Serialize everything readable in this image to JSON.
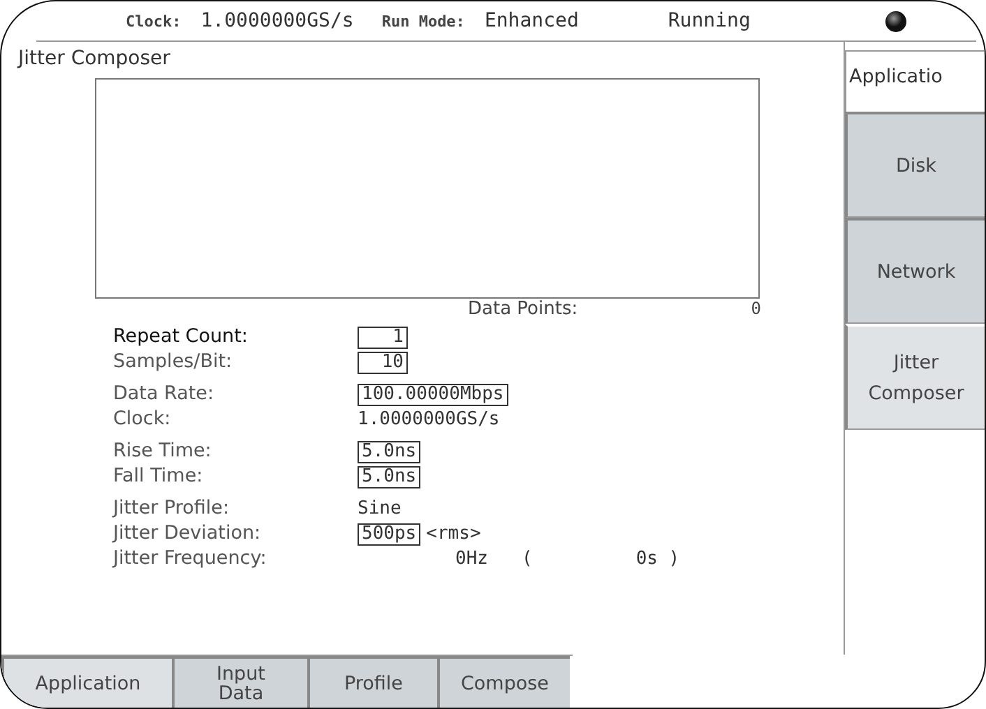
{
  "status_bar": {
    "clock_label": "Clock:",
    "clock_value": "1.0000000GS/s",
    "run_mode_label": "Run Mode:",
    "run_mode_value": "Enhanced",
    "state": "Running"
  },
  "panel_title": "Jitter Composer",
  "data_points": {
    "label": "Data Points:",
    "value": "0"
  },
  "groups": [
    [
      {
        "label": "Repeat Count:",
        "value": "1",
        "kind": "field",
        "emphasized": true
      },
      {
        "label": "Samples/Bit:",
        "value": "10",
        "kind": "field",
        "emphasized": false
      }
    ],
    [
      {
        "label": "Data Rate:",
        "value": "100.00000Mbps",
        "kind": "field",
        "emphasized": false
      },
      {
        "label": "Clock:",
        "value": "1.0000000GS/s",
        "kind": "text",
        "emphasized": false
      }
    ],
    [
      {
        "label": "Rise Time:",
        "value": "5.0ns",
        "kind": "field",
        "emphasized": false
      },
      {
        "label": "Fall Time:",
        "value": "5.0ns",
        "kind": "field",
        "emphasized": false
      }
    ],
    [
      {
        "label": "Jitter Profile:",
        "value": "Sine",
        "kind": "text",
        "emphasized": false
      },
      {
        "label": "Jitter Deviation:",
        "value": "500ps",
        "suffix": "<rms>",
        "kind": "field",
        "emphasized": false
      },
      {
        "label": "Jitter Frequency:",
        "value": "0Hz",
        "open": "(",
        "close": "0s )",
        "kind": "frequency",
        "emphasized": false
      }
    ]
  ],
  "side_menu": {
    "title": "Applicatio",
    "items": [
      {
        "label": "Disk",
        "selected": false
      },
      {
        "label": "Network",
        "selected": false
      },
      {
        "label": "Jitter Composer",
        "selected": true
      }
    ]
  },
  "bottom_tabs": [
    {
      "label": "Application",
      "selected": true
    },
    {
      "label": "Input Data",
      "selected": false
    },
    {
      "label": "Profile",
      "selected": false
    },
    {
      "label": "Compose",
      "selected": false
    }
  ]
}
